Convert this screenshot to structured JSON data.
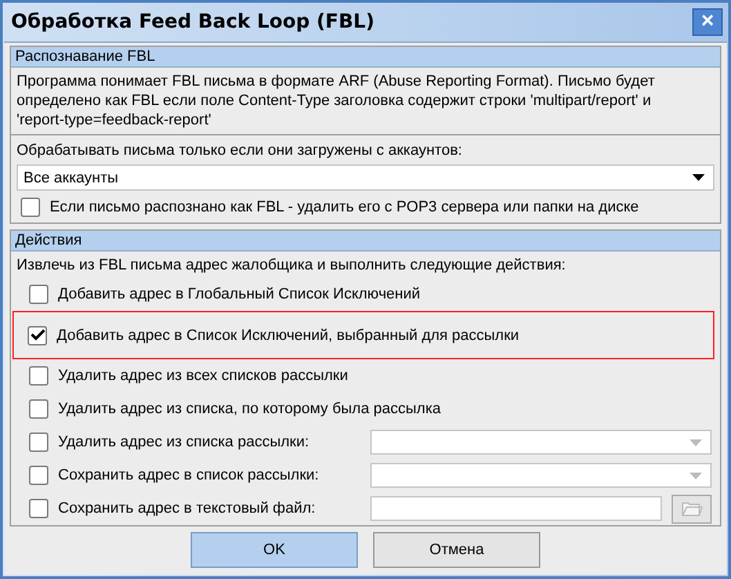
{
  "window": {
    "title": "Обработка Feed Back Loop (FBL)",
    "close_icon": "×"
  },
  "recognition": {
    "header": "Распознавание FBL",
    "description": "Программа понимает FBL письма в формате ARF (Abuse Reporting Format). Письмо будет определено как FBL если поле Content-Type заголовка содержит строки 'multipart/report' и 'report-type=feedback-report'",
    "accounts_label": "Обрабатывать письма только если они загружены с аккаунтов:",
    "accounts_value": "Все аккаунты",
    "delete_option": {
      "label": "Если письмо распознано как FBL - удалить его с POP3 сервера или папки на диске",
      "checked": false
    }
  },
  "actions": {
    "header": "Действия",
    "intro": "Извлечь из FBL письма адрес жалобщика и выполнить следующие действия:",
    "items": [
      {
        "kind": "checkbox",
        "label": "Добавить адрес в Глобальный Список Исключений",
        "checked": false,
        "highlighted": false
      },
      {
        "kind": "checkbox",
        "label": "Добавить адрес в Список Исключений, выбранный для рассылки",
        "checked": true,
        "highlighted": true
      },
      {
        "kind": "checkbox",
        "label": "Удалить адрес из всех списков рассылки",
        "checked": false,
        "highlighted": false
      },
      {
        "kind": "checkbox",
        "label": "Удалить адрес из списка, по которому была рассылка",
        "checked": false,
        "highlighted": false
      },
      {
        "kind": "combo",
        "label": "Удалить адрес из списка рассылки:",
        "checked": false,
        "highlighted": false
      },
      {
        "kind": "combo",
        "label": "Сохранить адрес в список рассылки:",
        "checked": false,
        "highlighted": false
      },
      {
        "kind": "file",
        "label": "Сохранить адрес в текстовый файл:",
        "checked": false,
        "highlighted": false
      }
    ]
  },
  "buttons": [
    {
      "label": "OK",
      "selected": true
    },
    {
      "label": "Отмена",
      "selected": false
    }
  ]
}
